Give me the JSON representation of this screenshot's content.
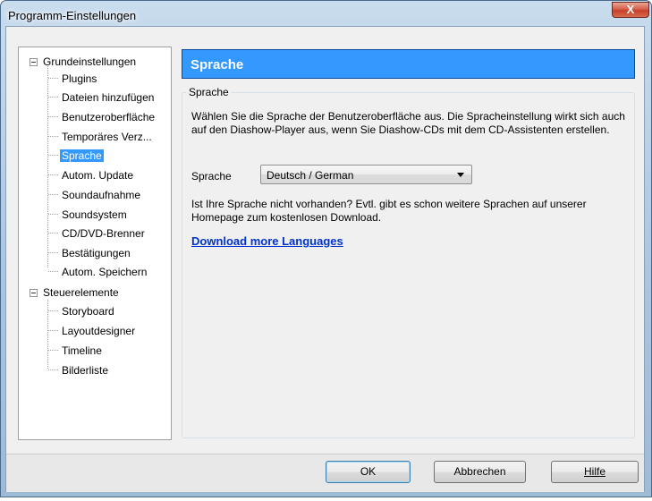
{
  "window": {
    "title": "Programm-Einstellungen",
    "close_label": "X"
  },
  "tree": {
    "groups": [
      {
        "label": "Grundeinstellungen",
        "items": [
          "Plugins",
          "Dateien hinzufügen",
          "Benutzeroberfläche",
          "Temporäres Verz...",
          "Sprache",
          "Autom. Update",
          "Soundaufnahme",
          "Soundsystem",
          "CD/DVD-Brenner",
          "Bestätigungen",
          "Autom. Speichern"
        ]
      },
      {
        "label": "Steuerelemente",
        "items": [
          "Storyboard",
          "Layoutdesigner",
          "Timeline",
          "Bilderliste"
        ]
      }
    ],
    "selected": "Sprache"
  },
  "panel": {
    "header": "Sprache",
    "group_title": "Sprache",
    "description": "Wählen Sie die Sprache der Benutzeroberfläche aus. Die Spracheinstellung wirkt sich auch auf den Diashow-Player aus, wenn Sie Diashow-CDs mit dem CD-Assistenten erstellen.",
    "language_label": "Sprache",
    "language_value": "Deutsch / German",
    "info": "Ist Ihre Sprache nicht vorhanden? Evtl. gibt es schon weitere Sprachen auf unserer Homepage zum kostenlosen Download.",
    "download_link": "Download more Languages"
  },
  "buttons": {
    "ok": "OK",
    "cancel": "Abbrechen",
    "help": "Hilfe"
  },
  "colors": {
    "selection": "#3399ff",
    "link": "#0033cc"
  }
}
